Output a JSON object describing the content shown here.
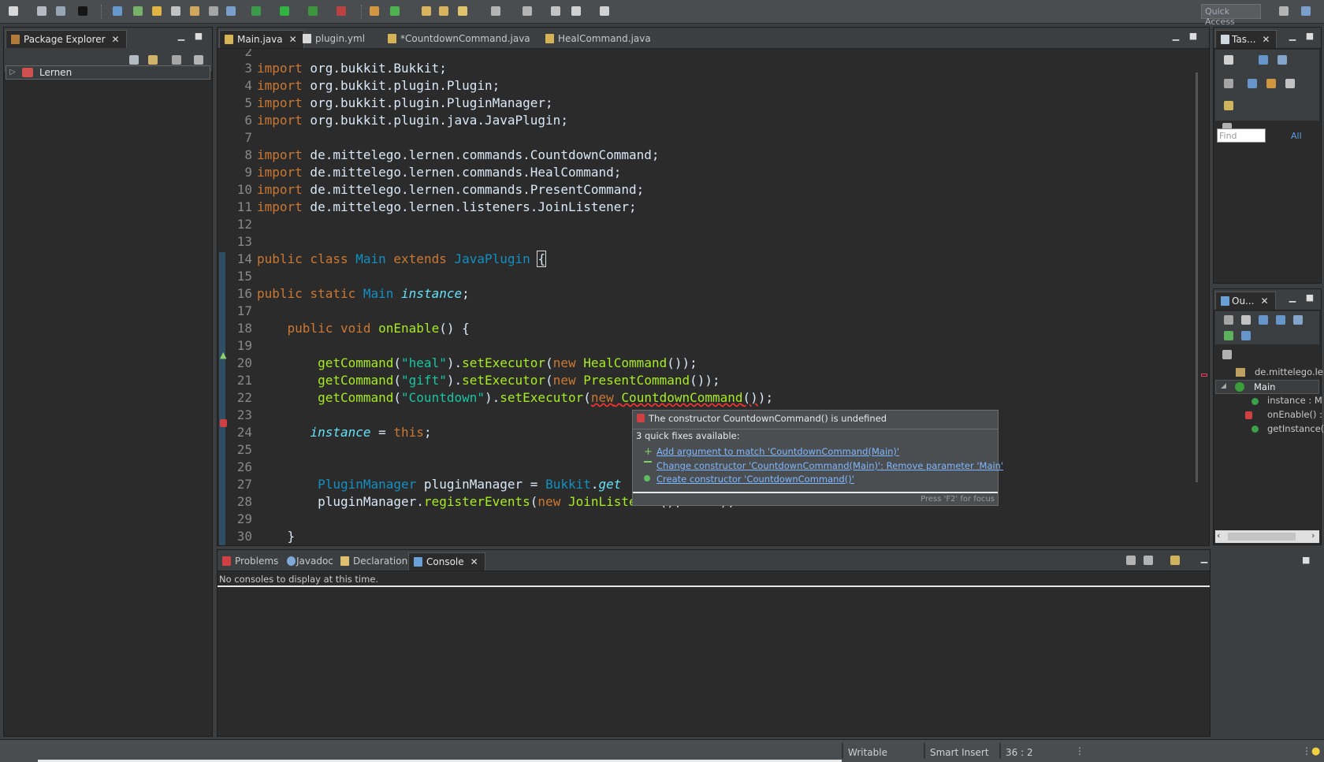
{
  "toolbar": {
    "quick_access": "Quick Access"
  },
  "package_explorer": {
    "title": "Package Explorer",
    "tree": [
      {
        "label": "Lernen",
        "expanded": false
      }
    ]
  },
  "editor": {
    "tabs": [
      {
        "label": "Main.java",
        "active": true,
        "icon": "java-file-icon"
      },
      {
        "label": "plugin.yml",
        "active": false,
        "icon": "text-file-icon"
      },
      {
        "label": "*CountdownCommand.java",
        "active": false,
        "icon": "java-file-icon"
      },
      {
        "label": "HealCommand.java",
        "active": false,
        "icon": "java-file-icon"
      }
    ],
    "line_numbers": [
      "2",
      "3",
      "4",
      "5",
      "6",
      "7",
      "8",
      "9",
      "10",
      "11",
      "12",
      "13",
      "14",
      "15",
      "16",
      "17",
      "18",
      "19",
      "20",
      "21",
      "22",
      "23",
      "24",
      "25",
      "26",
      "27",
      "28",
      "29",
      "30"
    ]
  },
  "quickfix": {
    "header": "The constructor CountdownCommand() is undefined",
    "subheader": "3 quick fixes available:",
    "items": [
      "Add argument to match 'CountdownCommand(Main)'",
      "Change constructor 'CountdownCommand(Main)': Remove parameter 'Main'",
      "Create constructor 'CountdownCommand()'"
    ],
    "footer": "Press 'F2' for focus"
  },
  "task_list": {
    "title": "Tas...",
    "find_placeholder": "Find",
    "all_label": "All"
  },
  "outline": {
    "title": "Ou...",
    "items": [
      {
        "label": "de.mittelego.ler"
      },
      {
        "label": "Main"
      },
      {
        "label": "instance : M"
      },
      {
        "label": "onEnable() :"
      },
      {
        "label": "getInstance("
      }
    ]
  },
  "bottom": {
    "tabs": [
      {
        "label": "Problems",
        "active": false
      },
      {
        "label": "Javadoc",
        "active": false
      },
      {
        "label": "Declaration",
        "active": false
      },
      {
        "label": "Console",
        "active": true
      }
    ],
    "console_message": "No consoles to display at this time."
  },
  "status": {
    "mode": "Writable",
    "insert": "Smart Insert",
    "position": "36 : 2"
  },
  "colors": {
    "keyword": "#cc7832",
    "type": "#1290c3",
    "string": "#17c6a3",
    "method": "#a7ec21",
    "field": "#66e1f8",
    "link": "#7fb7ff"
  }
}
